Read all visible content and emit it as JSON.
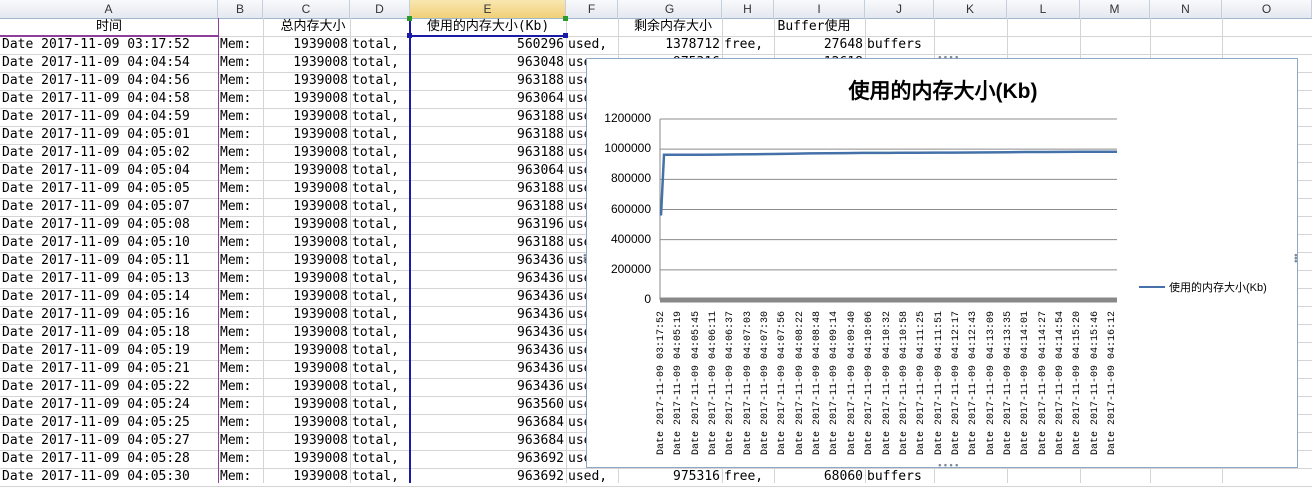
{
  "columns": [
    "A",
    "B",
    "C",
    "D",
    "E",
    "F",
    "G",
    "H",
    "I",
    "J",
    "K",
    "L",
    "M",
    "N",
    "O"
  ],
  "header_row": {
    "a": "时间",
    "c": "总内存大小",
    "e": "使用的内存大小(Kb)",
    "g": "剩余内存大小",
    "i": "Buffer使用"
  },
  "rows": [
    {
      "time": "Date 2017-11-09 03:17:52",
      "mem": "Mem:",
      "total": "1939008",
      "tlabel": "total,",
      "used": "560296",
      "ulabel": "used,",
      "free": "1378712",
      "flabel": "free,",
      "buf": "27648",
      "blabel": "buffers"
    },
    {
      "time": "Date 2017-11-09 04:04:54",
      "mem": "Mem:",
      "total": "1939008",
      "tlabel": "total,",
      "used": "963048",
      "ulabel": "use",
      "free": "",
      "flabel": "",
      "buf": "",
      "blabel": ""
    },
    {
      "time": "Date 2017-11-09 04:04:56",
      "mem": "Mem:",
      "total": "1939008",
      "tlabel": "total,",
      "used": "963188",
      "ulabel": "use",
      "free": "",
      "flabel": "",
      "buf": "",
      "blabel": ""
    },
    {
      "time": "Date 2017-11-09 04:04:58",
      "mem": "Mem:",
      "total": "1939008",
      "tlabel": "total,",
      "used": "963064",
      "ulabel": "use",
      "free": "",
      "flabel": "",
      "buf": "",
      "blabel": ""
    },
    {
      "time": "Date 2017-11-09 04:04:59",
      "mem": "Mem:",
      "total": "1939008",
      "tlabel": "total,",
      "used": "963188",
      "ulabel": "use",
      "free": "",
      "flabel": "",
      "buf": "",
      "blabel": ""
    },
    {
      "time": "Date 2017-11-09 04:05:01",
      "mem": "Mem:",
      "total": "1939008",
      "tlabel": "total,",
      "used": "963188",
      "ulabel": "use",
      "free": "",
      "flabel": "",
      "buf": "",
      "blabel": ""
    },
    {
      "time": "Date 2017-11-09 04:05:02",
      "mem": "Mem:",
      "total": "1939008",
      "tlabel": "total,",
      "used": "963188",
      "ulabel": "use",
      "free": "",
      "flabel": "",
      "buf": "",
      "blabel": ""
    },
    {
      "time": "Date 2017-11-09 04:05:04",
      "mem": "Mem:",
      "total": "1939008",
      "tlabel": "total,",
      "used": "963064",
      "ulabel": "use",
      "free": "",
      "flabel": "",
      "buf": "",
      "blabel": ""
    },
    {
      "time": "Date 2017-11-09 04:05:05",
      "mem": "Mem:",
      "total": "1939008",
      "tlabel": "total,",
      "used": "963188",
      "ulabel": "use",
      "free": "",
      "flabel": "",
      "buf": "",
      "blabel": ""
    },
    {
      "time": "Date 2017-11-09 04:05:07",
      "mem": "Mem:",
      "total": "1939008",
      "tlabel": "total,",
      "used": "963188",
      "ulabel": "use",
      "free": "",
      "flabel": "",
      "buf": "",
      "blabel": ""
    },
    {
      "time": "Date 2017-11-09 04:05:08",
      "mem": "Mem:",
      "total": "1939008",
      "tlabel": "total,",
      "used": "963196",
      "ulabel": "use",
      "free": "",
      "flabel": "",
      "buf": "",
      "blabel": ""
    },
    {
      "time": "Date 2017-11-09 04:05:10",
      "mem": "Mem:",
      "total": "1939008",
      "tlabel": "total,",
      "used": "963188",
      "ulabel": "use",
      "free": "",
      "flabel": "",
      "buf": "",
      "blabel": ""
    },
    {
      "time": "Date 2017-11-09 04:05:11",
      "mem": "Mem:",
      "total": "1939008",
      "tlabel": "total,",
      "used": "963436",
      "ulabel": "use",
      "free": "",
      "flabel": "",
      "buf": "",
      "blabel": ""
    },
    {
      "time": "Date 2017-11-09 04:05:13",
      "mem": "Mem:",
      "total": "1939008",
      "tlabel": "total,",
      "used": "963436",
      "ulabel": "use",
      "free": "",
      "flabel": "",
      "buf": "",
      "blabel": ""
    },
    {
      "time": "Date 2017-11-09 04:05:14",
      "mem": "Mem:",
      "total": "1939008",
      "tlabel": "total,",
      "used": "963436",
      "ulabel": "use",
      "free": "",
      "flabel": "",
      "buf": "",
      "blabel": ""
    },
    {
      "time": "Date 2017-11-09 04:05:16",
      "mem": "Mem:",
      "total": "1939008",
      "tlabel": "total,",
      "used": "963436",
      "ulabel": "use",
      "free": "",
      "flabel": "",
      "buf": "",
      "blabel": ""
    },
    {
      "time": "Date 2017-11-09 04:05:18",
      "mem": "Mem:",
      "total": "1939008",
      "tlabel": "total,",
      "used": "963436",
      "ulabel": "use",
      "free": "",
      "flabel": "",
      "buf": "",
      "blabel": ""
    },
    {
      "time": "Date 2017-11-09 04:05:19",
      "mem": "Mem:",
      "total": "1939008",
      "tlabel": "total,",
      "used": "963436",
      "ulabel": "use",
      "free": "",
      "flabel": "",
      "buf": "",
      "blabel": ""
    },
    {
      "time": "Date 2017-11-09 04:05:21",
      "mem": "Mem:",
      "total": "1939008",
      "tlabel": "total,",
      "used": "963436",
      "ulabel": "use",
      "free": "",
      "flabel": "",
      "buf": "",
      "blabel": ""
    },
    {
      "time": "Date 2017-11-09 04:05:22",
      "mem": "Mem:",
      "total": "1939008",
      "tlabel": "total,",
      "used": "963436",
      "ulabel": "use",
      "free": "",
      "flabel": "",
      "buf": "",
      "blabel": ""
    },
    {
      "time": "Date 2017-11-09 04:05:24",
      "mem": "Mem:",
      "total": "1939008",
      "tlabel": "total,",
      "used": "963560",
      "ulabel": "use",
      "free": "",
      "flabel": "",
      "buf": "",
      "blabel": ""
    },
    {
      "time": "Date 2017-11-09 04:05:25",
      "mem": "Mem:",
      "total": "1939008",
      "tlabel": "total,",
      "used": "963684",
      "ulabel": "use",
      "free": "",
      "flabel": "",
      "buf": "",
      "blabel": ""
    },
    {
      "time": "Date 2017-11-09 04:05:27",
      "mem": "Mem:",
      "total": "1939008",
      "tlabel": "total,",
      "used": "963684",
      "ulabel": "use",
      "free": "",
      "flabel": "",
      "buf": "",
      "blabel": ""
    },
    {
      "time": "Date 2017-11-09 04:05:28",
      "mem": "Mem:",
      "total": "1939008",
      "tlabel": "total,",
      "used": "963692",
      "ulabel": "use",
      "free": "",
      "flabel": "",
      "buf": "",
      "blabel": ""
    },
    {
      "time": "Date 2017-11-09 04:05:30",
      "mem": "Mem:",
      "total": "1939008",
      "tlabel": "total,",
      "used": "963692",
      "ulabel": "used,",
      "free": "975316",
      "flabel": "free,",
      "buf": "68060",
      "blabel": "buffers"
    }
  ],
  "row2_partial": {
    "g": "975316",
    "i": "12618"
  },
  "chart_data": {
    "type": "line",
    "title": "使用的内存大小(Kb)",
    "ylim": [
      0,
      1200000
    ],
    "yticks": [
      "1200000",
      "1000000",
      "800000",
      "600000",
      "400000",
      "200000",
      "0"
    ],
    "x_tick_labels": [
      "Date 2017-11-09 03:17:52",
      "Date 2017-11-09 04:05:19",
      "Date 2017-11-09 04:05:45",
      "Date 2017-11-09 04:06:11",
      "Date 2017-11-09 04:06:37",
      "Date 2017-11-09 04:07:03",
      "Date 2017-11-09 04:07:30",
      "Date 2017-11-09 04:07:56",
      "Date 2017-11-09 04:08:22",
      "Date 2017-11-09 04:08:48",
      "Date 2017-11-09 04:09:14",
      "Date 2017-11-09 04:09:40",
      "Date 2017-11-09 04:10:06",
      "Date 2017-11-09 04:10:32",
      "Date 2017-11-09 04:10:58",
      "Date 2017-11-09 04:11:25",
      "Date 2017-11-09 04:11:51",
      "Date 2017-11-09 04:12:17",
      "Date 2017-11-09 04:12:43",
      "Date 2017-11-09 04:13:09",
      "Date 2017-11-09 04:13:35",
      "Date 2017-11-09 04:14:01",
      "Date 2017-11-09 04:14:27",
      "Date 2017-11-09 04:14:54",
      "Date 2017-11-09 04:15:20",
      "Date 2017-11-09 04:15:46",
      "Date 2017-11-09 04:16:12"
    ],
    "series": [
      {
        "name": "使用的内存大小(Kb)",
        "color": "#4472a8",
        "values": [
          560296,
          963048,
          963188,
          963436,
          963692,
          965000,
          966500,
          968000,
          970000,
          972000,
          973000,
          974000,
          975000,
          975500,
          976000,
          976500,
          977000,
          977500,
          978000,
          978500,
          980000,
          981000,
          981500,
          982000,
          982500,
          983000,
          983500
        ]
      }
    ],
    "legend": "right",
    "grid": true
  }
}
